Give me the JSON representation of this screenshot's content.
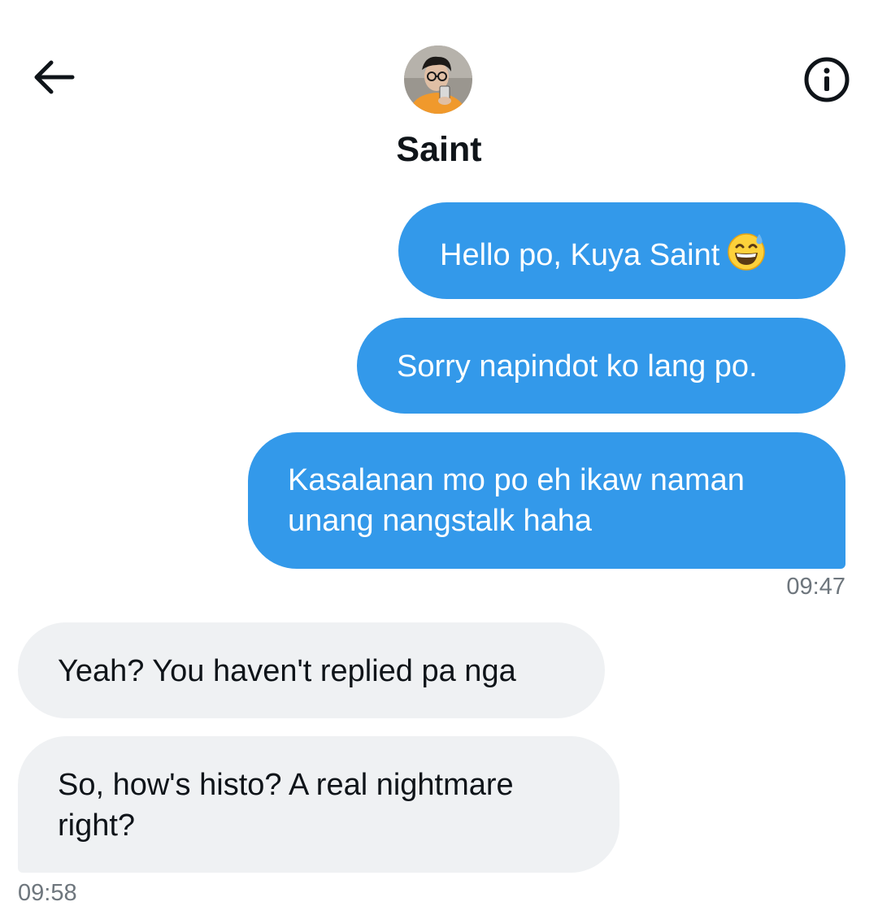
{
  "header": {
    "contact_name": "Saint",
    "back_icon": "arrow-left-icon",
    "info_icon": "info-circle-icon"
  },
  "messages": [
    {
      "direction": "sent",
      "text": "Hello po, Kuya Saint",
      "emoji": "grinning-face-with-sweat"
    },
    {
      "direction": "sent",
      "text": "Sorry napindot ko lang po."
    },
    {
      "direction": "sent",
      "text": "Kasalanan mo po eh ikaw naman unang nangstalk haha"
    },
    {
      "direction": "received",
      "text": "Yeah? You haven't replied pa nga"
    },
    {
      "direction": "received",
      "text": "So, how's histo? A real nightmare right?"
    }
  ],
  "timestamps": {
    "sent_group": "09:47",
    "received_group": "09:58"
  },
  "colors": {
    "sent_bubble": "#3399ea",
    "received_bubble": "#eff1f3",
    "text_dark": "#0f1419",
    "timestamp": "#6e767d"
  }
}
